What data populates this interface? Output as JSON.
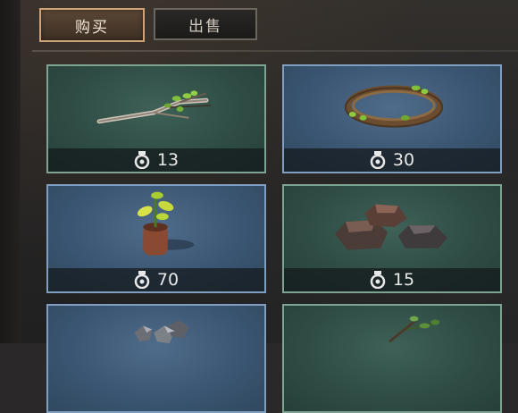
{
  "tabs": {
    "buy_label": "购买",
    "sell_label": "出售"
  },
  "items": [
    {
      "price": "13",
      "bg": "green",
      "icon": "branch-icon"
    },
    {
      "price": "30",
      "bg": "blue",
      "icon": "vine-wreath-icon"
    },
    {
      "price": "70",
      "bg": "blue",
      "icon": "sapling-icon"
    },
    {
      "price": "15",
      "bg": "green",
      "icon": "rocks-icon"
    },
    {
      "price": "",
      "bg": "blue",
      "icon": "ore-icon"
    },
    {
      "price": "",
      "bg": "green",
      "icon": "plant-icon"
    }
  ],
  "colors": {
    "active_tab_border": "#d0a27a",
    "green_card": "#2f4d45",
    "blue_card": "#3b5673",
    "price_text": "#e8e8e8"
  }
}
